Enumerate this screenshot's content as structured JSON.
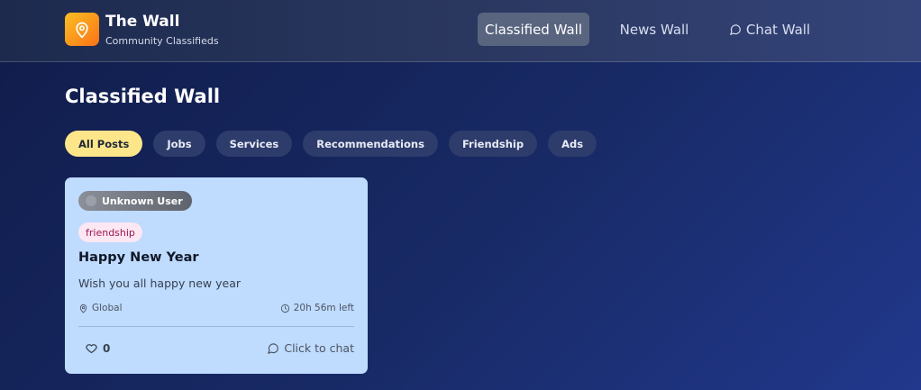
{
  "brand": {
    "title": "The Wall",
    "subtitle": "Community Classifieds",
    "logo_icon": "map-pin-icon",
    "logo_color": "#f59e0b"
  },
  "nav": {
    "items": [
      {
        "label": "Classified Wall",
        "active": true
      },
      {
        "label": "News Wall",
        "active": false
      },
      {
        "label": "Chat Wall",
        "active": false,
        "icon": "chat-bubble-icon"
      }
    ]
  },
  "page": {
    "title": "Classified Wall"
  },
  "filters": {
    "items": [
      {
        "label": "All Posts",
        "active": true
      },
      {
        "label": "Jobs",
        "active": false
      },
      {
        "label": "Services",
        "active": false
      },
      {
        "label": "Recommendations",
        "active": false
      },
      {
        "label": "Friendship",
        "active": false
      },
      {
        "label": "Ads",
        "active": false
      }
    ],
    "active_color": "#fde68a"
  },
  "posts": [
    {
      "user": "Unknown User",
      "tag": "friendship",
      "title": "Happy New Year",
      "body": "Wish you all happy new year",
      "location": "Global",
      "time_left": "20h 56m left",
      "likes": "0",
      "chat_label": "Click to chat",
      "card_color": "#bfdbfe"
    }
  ]
}
